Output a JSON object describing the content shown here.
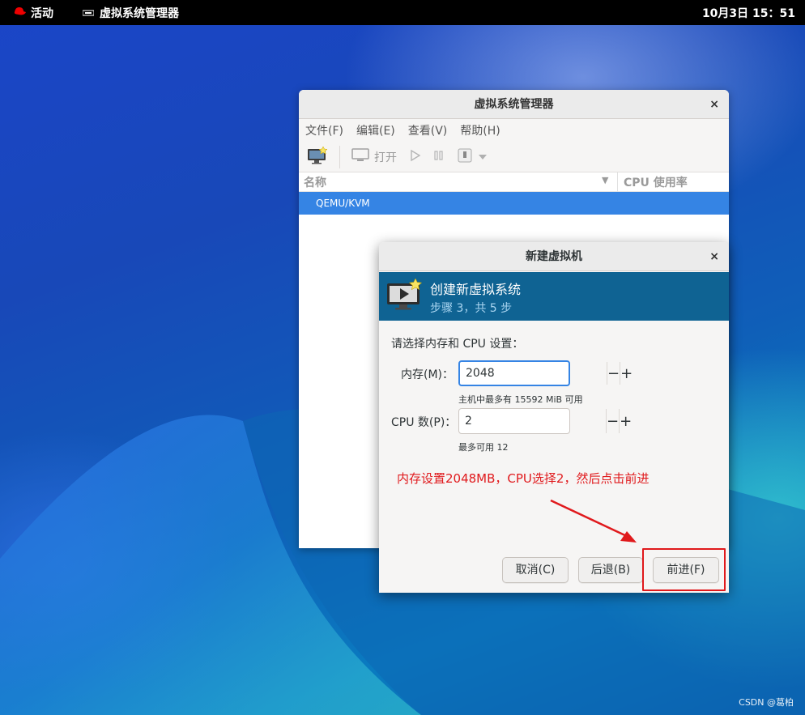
{
  "topbar": {
    "activities_label": "活动",
    "app_label": "虚拟系统管理器",
    "clock": "10月3日  15：51"
  },
  "main_window": {
    "title": "虚拟系统管理器",
    "close_glyph": "×",
    "menu": [
      "文件(F)",
      "编辑(E)",
      "查看(V)",
      "帮助(H)"
    ],
    "toolbar": {
      "open_label": "打开"
    },
    "columns": {
      "name": "名称",
      "cpu": "CPU 使用率"
    },
    "connections": [
      "QEMU/KVM"
    ]
  },
  "dialog": {
    "title": "新建虚拟机",
    "close_glyph": "×",
    "banner_title": "创建新虚拟系统",
    "banner_subtitle": "步骤 3，共 5 步",
    "prompt": "请选择内存和 CPU 设置：",
    "memory": {
      "label": "内存(M)：",
      "value": "2048",
      "hint": "主机中最多有 15592 MiB 可用"
    },
    "cpu": {
      "label": "CPU 数(P)：",
      "value": "2",
      "hint": "最多可用 12"
    },
    "minus_glyph": "−",
    "plus_glyph": "+",
    "buttons": {
      "cancel": "取消(C)",
      "back": "后退(B)",
      "forward": "前进(F)"
    }
  },
  "annotation": {
    "text": "内存设置2048MB，CPU选择2，然后点击前进",
    "color": "#e0191c"
  },
  "watermark": "CSDN @葛柏",
  "colors": {
    "accent": "#3584e4",
    "banner": "#0f6393"
  }
}
